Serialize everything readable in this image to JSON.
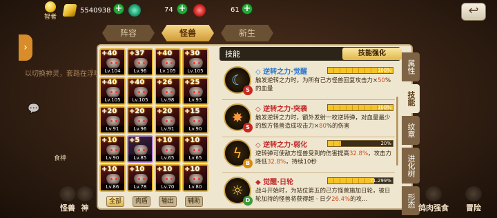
{
  "topbar": {
    "wise_label": "智者",
    "gold": "5540938",
    "green_gem": "74",
    "red_gem": "61",
    "back_glyph": "↩"
  },
  "background": {
    "hint_text": "以切换神灵，套路在浮唤",
    "food_label": "食神"
  },
  "top_tabs": [
    "阵容",
    "怪兽",
    "新生"
  ],
  "active_top_tab": 1,
  "side_tab_glyph": "›",
  "monster_grid": [
    {
      "plus": "+40",
      "level": "Lv.104"
    },
    {
      "plus": "+37",
      "level": "Lv.96"
    },
    {
      "plus": "+40",
      "level": "Lv.105"
    },
    {
      "plus": "+30",
      "level": "Lv.105"
    },
    {
      "plus": "+40",
      "level": "Lv.105"
    },
    {
      "plus": "+40",
      "level": "Lv.105"
    },
    {
      "plus": "+26",
      "level": "Lv.98"
    },
    {
      "plus": "+25",
      "level": "Lv.93"
    },
    {
      "plus": "+20",
      "level": "Lv.91"
    },
    {
      "plus": "+20",
      "level": "Lv.96"
    },
    {
      "plus": "+20",
      "level": "Lv.91"
    },
    {
      "plus": "+15",
      "level": "Lv.90"
    },
    {
      "plus": "+10",
      "level": "Lv.90"
    },
    {
      "plus": "+5",
      "level": "Lv.85"
    },
    {
      "plus": "+10",
      "level": "Lv.65"
    },
    {
      "plus": "+10",
      "level": "Lv.65"
    },
    {
      "plus": "+10",
      "level": "Lv.86"
    },
    {
      "plus": "+10",
      "level": "Lv.78"
    },
    {
      "plus": "+10",
      "level": "Lv.70"
    },
    {
      "plus": "+10",
      "level": "Lv.80"
    }
  ],
  "filters": [
    "全部",
    "肉盾",
    "输出",
    "辅助"
  ],
  "active_filter": 0,
  "skill_panel": {
    "title": "技能",
    "enhance_button": "技能强化"
  },
  "skills": [
    {
      "name": "逆转之力·觉醒",
      "progress": "100%",
      "progress_fraction": 1.0,
      "grade": "S",
      "desc_a": "触发逆转之力时，为所有己方怪兽回复攻击力×",
      "desc_hl": "50",
      "desc_b": "%的血量"
    },
    {
      "name": "逆转之力·突袭",
      "progress": "100%",
      "progress_fraction": 1.0,
      "grade": "S",
      "desc_a": "触发逆转之力时，额外发射一枚逆转弹，对血量最少的敌方怪兽造成攻击力×",
      "desc_hl": "80",
      "desc_b": "%的伤害"
    },
    {
      "name": "逆转之力·弱化",
      "progress": "20%",
      "progress_fraction": 0.2,
      "grade": "B",
      "desc_a": "逆转弹可使敌方怪兽受到的伤害提高",
      "desc_hl": "32.8%",
      "desc_b": "，攻击力降低",
      "desc_hl2": "32.8%",
      "desc_c": "，持续10秒"
    },
    {
      "name": "觉醒·日轮",
      "progress": "71.299%",
      "progress_fraction": 0.713,
      "grade": "D",
      "desc_a": "战斗开始时，为站位第五的己方怪兽施加日轮，被日轮加持的怪兽将获得超 · 日夕",
      "desc_hl": "26.4%",
      "desc_b": "的攻..."
    }
  ],
  "right_tabs": [
    "属性",
    "技能",
    "纹章",
    "进化树",
    "形态"
  ],
  "active_right_tab": 1,
  "bottom_nav": [
    "怪兽",
    "神",
    "",
    "",
    "",
    "",
    "",
    "",
    "",
    "鸽肉强食",
    "冒险"
  ],
  "colors": {
    "accent_gold": "#e1b648",
    "skill_name_blue": "#2a78d0",
    "skill_name_red": "#c22a2a",
    "highlight": "#d04a18",
    "plus_green": "#27a83a"
  }
}
